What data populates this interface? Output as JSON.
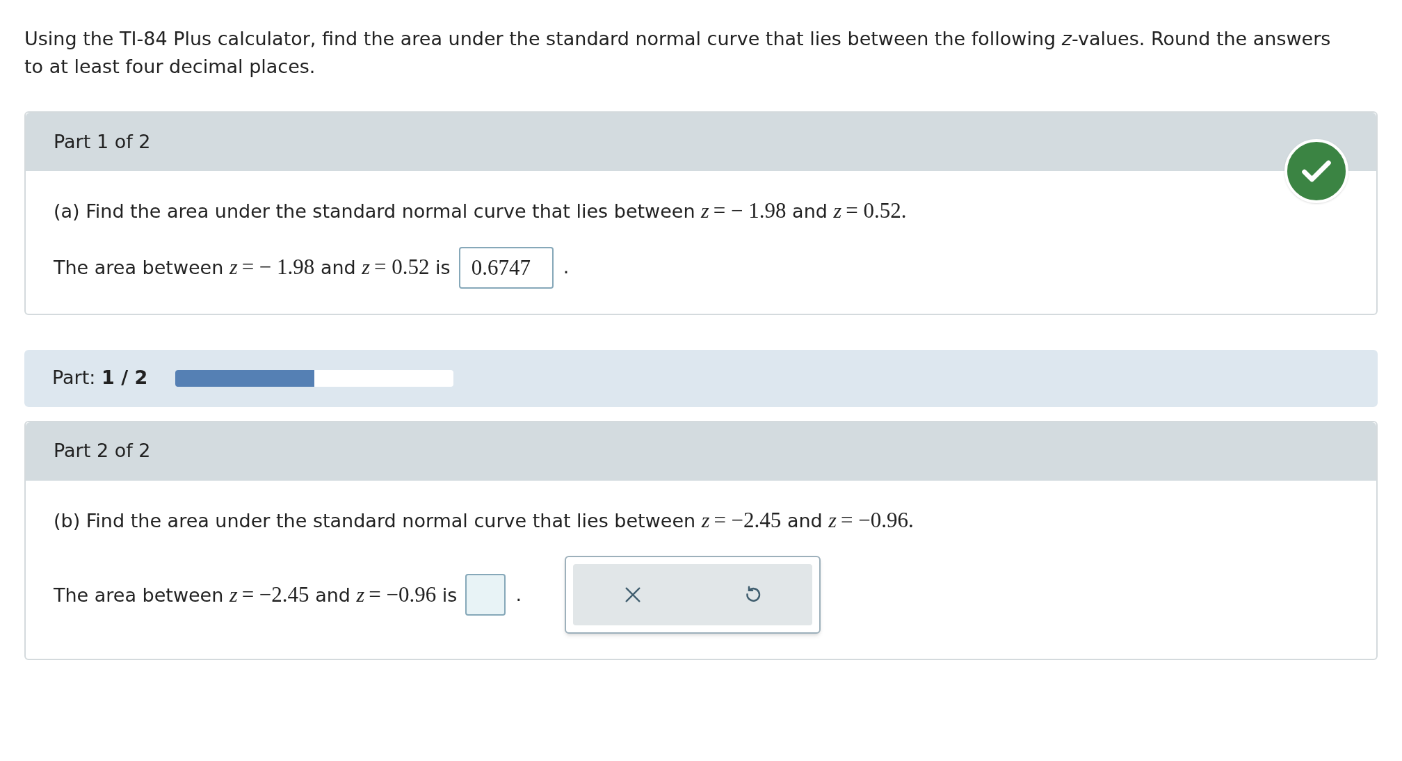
{
  "question": "Using the TI-84 Plus calculator, find the area under the standard normal curve that lies between the following *z*-values. Round the answers to at least four decimal places.",
  "parts": [
    {
      "title": "Part 1 of 2",
      "correct": true,
      "prompt": [
        {
          "kind": "text",
          "text": "(a) Find the area under the standard normal curve that lies between "
        },
        {
          "kind": "var",
          "text": "z"
        },
        {
          "kind": "num",
          "text": "= − 1.98"
        },
        {
          "kind": "text",
          "text": " and "
        },
        {
          "kind": "var",
          "text": "z"
        },
        {
          "kind": "num",
          "text": "= 0.52."
        }
      ],
      "answer_lead": [
        {
          "kind": "text",
          "text": "The area between "
        },
        {
          "kind": "var",
          "text": "z"
        },
        {
          "kind": "num",
          "text": "= − 1.98"
        },
        {
          "kind": "text",
          "text": " and "
        },
        {
          "kind": "var",
          "text": "z"
        },
        {
          "kind": "num",
          "text": "= 0.52"
        },
        {
          "kind": "text",
          "text": " is"
        }
      ],
      "answer": "0.6747",
      "answer_end": ".",
      "keypad": false
    },
    {
      "title": "Part 2 of 2",
      "correct": false,
      "prompt": [
        {
          "kind": "text",
          "text": "(b) Find the area under the standard normal curve that lies between "
        },
        {
          "kind": "var",
          "text": "z"
        },
        {
          "kind": "num",
          "text": "= −2.45"
        },
        {
          "kind": "text",
          "text": " and "
        },
        {
          "kind": "var",
          "text": "z"
        },
        {
          "kind": "num",
          "text": "= −0.96."
        }
      ],
      "answer_lead": [
        {
          "kind": "text",
          "text": "The area between "
        },
        {
          "kind": "var",
          "text": "z"
        },
        {
          "kind": "num",
          "text": "= −2.45"
        },
        {
          "kind": "text",
          "text": " and "
        },
        {
          "kind": "var",
          "text": "z"
        },
        {
          "kind": "num",
          "text": "= −0.96"
        },
        {
          "kind": "text",
          "text": " is"
        }
      ],
      "answer_end": ".",
      "keypad": true
    }
  ],
  "progress": {
    "label": "Part: **1 / 2**",
    "level": 0.5
  }
}
